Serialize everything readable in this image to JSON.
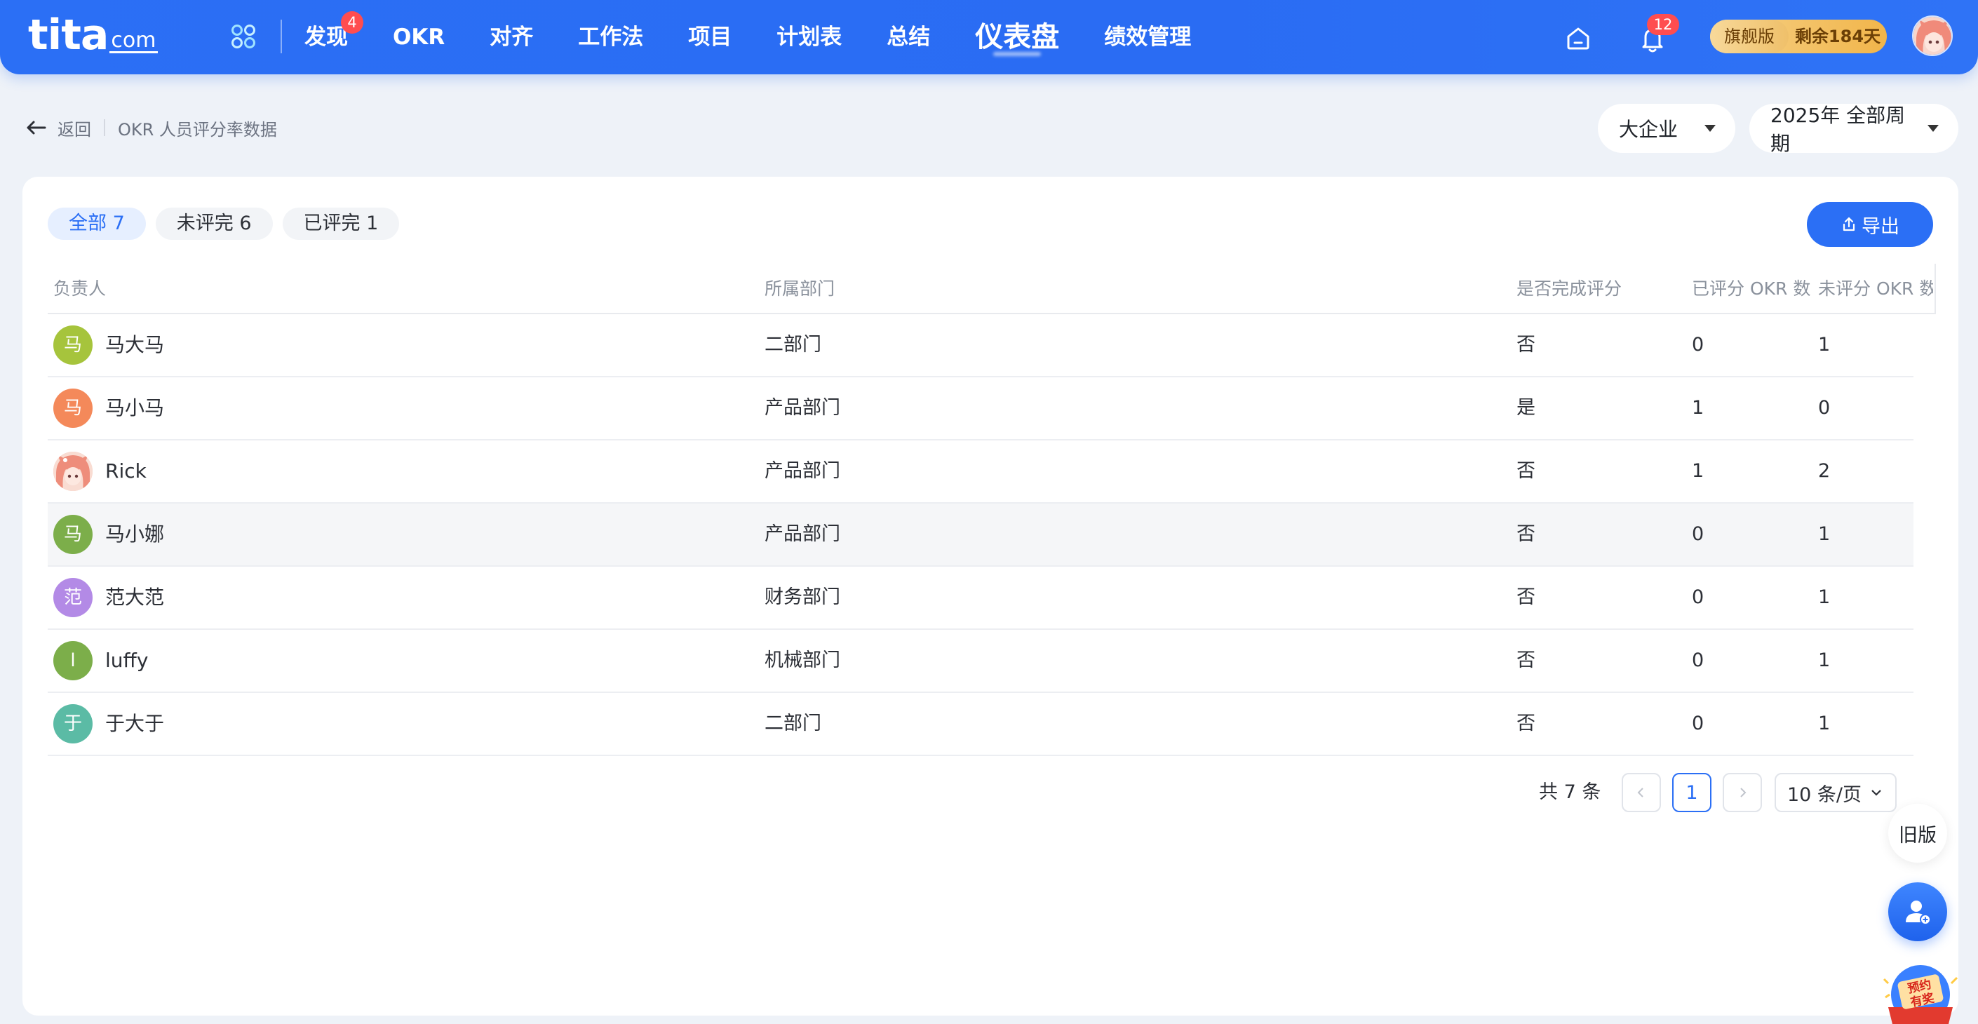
{
  "nav": {
    "logo_main": "tita",
    "logo_suffix": "com",
    "items": [
      {
        "label": "发现",
        "badge": "4"
      },
      {
        "label": "OKR"
      },
      {
        "label": "对齐"
      },
      {
        "label": "工作法"
      },
      {
        "label": "项目"
      },
      {
        "label": "计划表"
      },
      {
        "label": "总结"
      },
      {
        "label": "仪表盘",
        "active": true
      },
      {
        "label": "绩效管理"
      }
    ],
    "notification_count": "12",
    "plan_tier": "旗舰版",
    "plan_remaining": "剩余184天"
  },
  "header": {
    "back_label": "返回",
    "page_title": "OKR 人员评分率数据",
    "org_select": "大企业",
    "period_select": "2025年 全部周期"
  },
  "tabs": [
    {
      "label": "全部 7",
      "active": true
    },
    {
      "label": "未评完 6"
    },
    {
      "label": "已评完 1"
    }
  ],
  "export_label": "导出",
  "table": {
    "columns": [
      "负责人",
      "所属部门",
      "是否完成评分",
      "已评分 OKR 数",
      "未评分 OKR 数"
    ],
    "rows": [
      {
        "avatar": "马",
        "avatar_color": "#a6c43c",
        "name": "马大马",
        "dept": "二部门",
        "done": "否",
        "rated": "0",
        "unrated": "1"
      },
      {
        "avatar": "马",
        "avatar_color": "#f4895a",
        "name": "马小马",
        "dept": "产品部门",
        "done": "是",
        "rated": "1",
        "unrated": "0"
      },
      {
        "avatar": "",
        "avatar_color": "#f6c6b6",
        "avatar_image": "anime-girl-avatar",
        "name": "Rick",
        "dept": "产品部门",
        "done": "否",
        "rated": "1",
        "unrated": "2"
      },
      {
        "avatar": "马",
        "avatar_color": "#7cae4a",
        "name": "马小娜",
        "dept": "产品部门",
        "done": "否",
        "rated": "0",
        "unrated": "1",
        "hover": true
      },
      {
        "avatar": "范",
        "avatar_color": "#b38ae6",
        "name": "范大范",
        "dept": "财务部门",
        "done": "否",
        "rated": "0",
        "unrated": "1"
      },
      {
        "avatar": "l",
        "avatar_color": "#7cae4a",
        "name": "luffy",
        "dept": "机械部门",
        "done": "否",
        "rated": "0",
        "unrated": "1"
      },
      {
        "avatar": "于",
        "avatar_color": "#5bbba5",
        "name": "于大于",
        "dept": "二部门",
        "done": "否",
        "rated": "0",
        "unrated": "1"
      }
    ]
  },
  "pagination": {
    "total_label": "共 7 条",
    "current_page": "1",
    "page_size": "10 条/页"
  },
  "floating": {
    "old_version": "旧版",
    "promo_line1": "预约",
    "promo_line2": "有奖"
  },
  "colors": {
    "primary": "#2b6ff5",
    "badge": "#ff4d4f",
    "plan_gold": "#f1b54a"
  }
}
